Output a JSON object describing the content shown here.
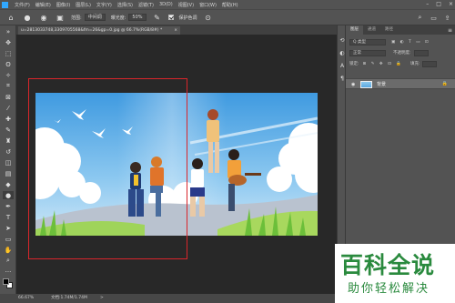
{
  "menubar": {
    "items": [
      "文件(F)",
      "编辑(E)",
      "图像(I)",
      "图层(L)",
      "文字(Y)",
      "选择(S)",
      "滤镜(T)",
      "3D(D)",
      "视图(V)",
      "窗口(W)",
      "帮助(H)"
    ]
  },
  "options": {
    "range_label": "范围:",
    "range_value": "中间调",
    "exposure_label": "曝光度:",
    "exposure_value": "50%",
    "protect_label": "保护色调"
  },
  "document": {
    "tab_title": "u=2813033748,3309705568&fm=26&gp=0.jpg @ 66.7%(RGB/8#) *",
    "close_glyph": "×"
  },
  "status": {
    "zoom": "66.67%",
    "doc_size": "文档:1.74M/1.74M",
    "arrow": ">"
  },
  "panel": {
    "tabs": [
      "图层",
      "通道",
      "路径"
    ],
    "kind_label": "Q 类型",
    "blend_mode": "正常",
    "opacity_label": "不透明度:",
    "lock_label": "锁定:",
    "fill_label": "填充:",
    "layer_name": "背景"
  },
  "watermark": {
    "big": "百科全说",
    "small": "助你轻松解决"
  },
  "colors": {
    "ui_bg": "#535353",
    "canvas_bg": "#282828",
    "selection": "#d9252b",
    "accent_blue": "#31a8ff",
    "watermark_green": "#2a8a3e"
  }
}
